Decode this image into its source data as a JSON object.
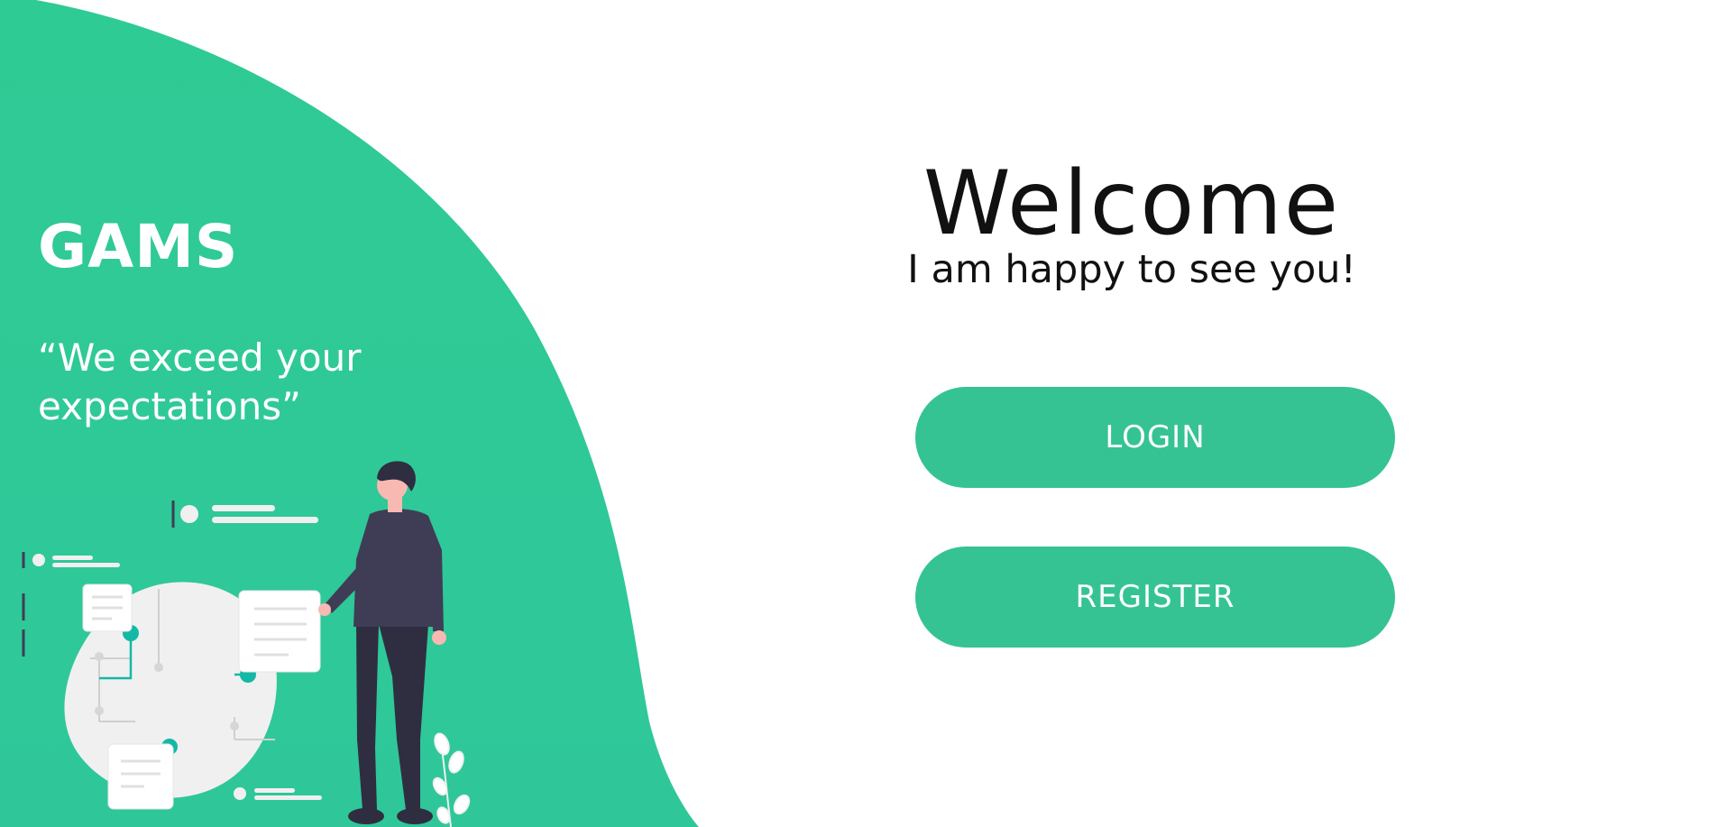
{
  "brand": {
    "name": "GAMS",
    "tagline": "“We exceed your expectations”"
  },
  "welcome": {
    "title": "Welcome",
    "subtitle": "I am happy to see you!"
  },
  "actions": {
    "login_label": "LOGIN",
    "register_label": "REGISTER"
  },
  "colors": {
    "hero_green": "#2fcb94",
    "button_green": "#35c394",
    "text_dark": "#111111",
    "figure_dark": "#3f3d56",
    "accent_teal": "#14b8a6"
  },
  "icons": {
    "illustration": "person-with-documents-illustration"
  }
}
